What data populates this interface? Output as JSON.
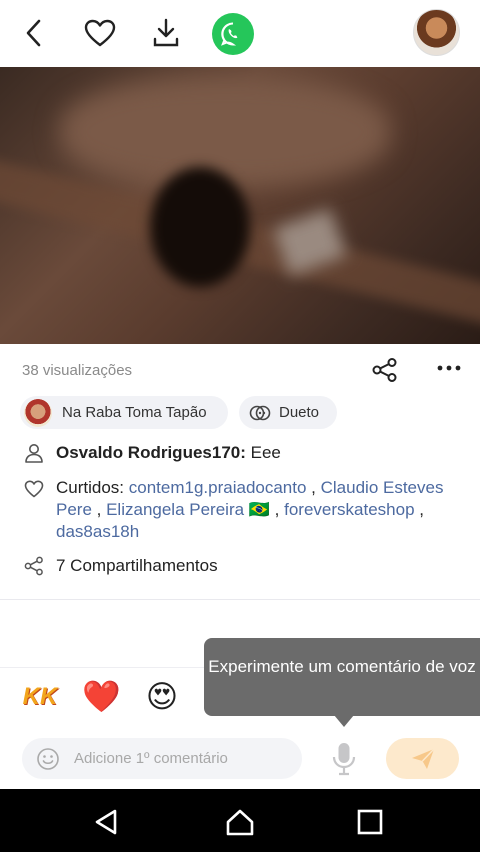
{
  "header": {
    "back_icon": "back-arrow-icon",
    "like_icon": "heart-outline-icon",
    "download_icon": "download-icon",
    "whatsapp_icon": "whatsapp-icon",
    "whatsapp_color": "#25C65A"
  },
  "stats": {
    "views": "38 visualizações"
  },
  "chips": {
    "music_title": "Na Raba Toma Tapão",
    "duet_label": "Dueto"
  },
  "caption": {
    "author": "Osvaldo Rodrigues170:",
    "text": "Eee"
  },
  "likes": {
    "prefix": "Curtidos:",
    "users": [
      "contem1g.praiadocanto",
      "Claudio Esteves Pere",
      "Elizangela Pereira 🇧🇷",
      "foreverskateshop",
      "das8as18h"
    ],
    "link_color": "#4D6AA0"
  },
  "shares": {
    "text": "7 Compartilhamentos"
  },
  "emojis": [
    "KK",
    "❤️",
    "😍",
    "😂",
    "😘",
    "😄",
    "😎",
    "👏"
  ],
  "tooltip": {
    "text": "Experimente um comentário de voz"
  },
  "comment": {
    "placeholder": "Adicione 1º comentário"
  },
  "colors": {
    "send_button_bg": "#FDE9CC",
    "tooltip_bg": "#6B6B6B"
  }
}
